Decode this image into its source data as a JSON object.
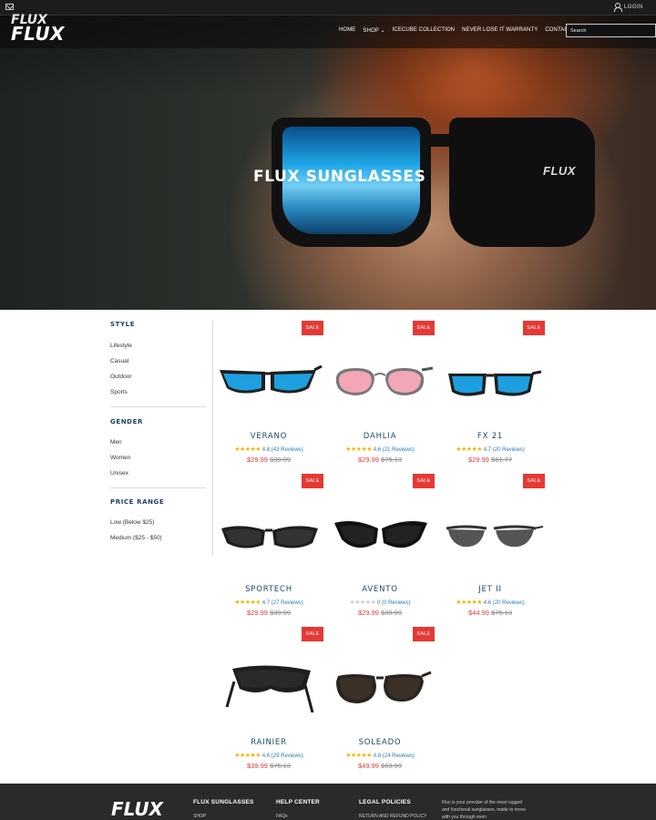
{
  "topbar": {
    "mail_icon": "mail-icon",
    "login_label": "LOGIN"
  },
  "nav": {
    "logo_top": "FLUX",
    "logo_main": "FLUX",
    "menu": [
      "HOME",
      "SHOP",
      "ICECUBE COLLECTION",
      "NEVER LOSE IT WARRANTY",
      "CONTACT US"
    ],
    "search_placeholder": "Search"
  },
  "hero": {
    "title": "FLUX SUNGLASSES",
    "glasses_mark": "FLUX"
  },
  "filters": {
    "style": {
      "title": "STYLE",
      "items": [
        "Lifestyle",
        "Casual",
        "Outdoor",
        "Sports"
      ]
    },
    "gender": {
      "title": "GENDER",
      "items": [
        "Men",
        "Women",
        "Unisex"
      ]
    },
    "price": {
      "title": "PRICE RANGE",
      "items": [
        "Low (Below $25)",
        "Medium ($25 - $50)"
      ]
    }
  },
  "sale_label": "SALE",
  "products": [
    {
      "name": "VERANO",
      "stars": 5,
      "rating": "4.8 (43 Reviews)",
      "price": "$29.99",
      "was": "$39.99",
      "lens": "#1e9fe0"
    },
    {
      "name": "DAHLIA",
      "stars": 5,
      "rating": "4.6 (21 Reviews)",
      "price": "$29.99",
      "was": "$75.13",
      "lens": "#f2a6b6"
    },
    {
      "name": "FX 21",
      "stars": 5,
      "rating": "4.7 (20 Reviews)",
      "price": "$29.99",
      "was": "$61.77",
      "lens": "#1e9fe0"
    },
    {
      "name": "SPORTECH",
      "stars": 5,
      "rating": "4.7 (27 Reviews)",
      "price": "$29.99",
      "was": "$39.99",
      "lens": "#333333"
    },
    {
      "name": "AVENTO",
      "stars": 0,
      "rating": "0 (0 Reviews)",
      "price": "$29.99",
      "was": "$39.99",
      "lens": "#222222"
    },
    {
      "name": "JET II",
      "stars": 5,
      "rating": "4.6 (20 Reviews)",
      "price": "$44.99",
      "was": "$75.13",
      "lens": "#555555"
    },
    {
      "name": "RAINIER",
      "stars": 5,
      "rating": "4.6 (29 Reviews)",
      "price": "$39.99",
      "was": "$75.13",
      "lens": "#2a2a2a"
    },
    {
      "name": "SOLEADO",
      "stars": 5,
      "rating": "4.8 (24 Reviews)",
      "price": "$49.99",
      "was": "$69.99",
      "lens": "#3a3028"
    }
  ],
  "footer": {
    "logo": "FLUX",
    "col1": {
      "title": "FLUX SUNGLASSES",
      "first": "SHOP"
    },
    "col2": {
      "title": "HELP CENTER",
      "first": "FAQs"
    },
    "col3": {
      "title": "LEGAL POLICIES",
      "first": "RETURN AND REFUND POLICY"
    },
    "about": "Flux is your provider of the most rugged and functional sunglasses, made to move with you through even"
  },
  "colors": {
    "accent": "#1d4a6e",
    "sale": "#e53935",
    "star": "#f5b301"
  }
}
